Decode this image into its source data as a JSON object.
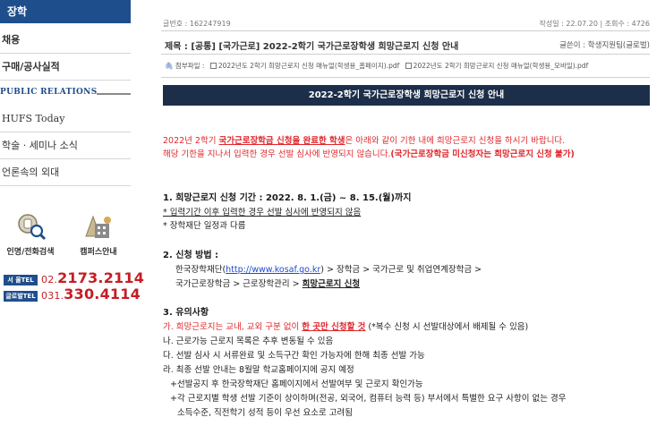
{
  "sidebar": {
    "active": "장학",
    "items": [
      "채용",
      "구매/공사실적"
    ],
    "section": "PUBLIC RELATIONS",
    "pr_items": [
      "HUFS Today",
      "학술 · 세미나 소식",
      "언론속의 외대"
    ],
    "quick": [
      {
        "label": "인명/전화검색",
        "icon": "phone-search-icon"
      },
      {
        "label": "캠퍼스안내",
        "icon": "campus-map-icon"
      }
    ],
    "tels": [
      {
        "badge": "서 울TEL",
        "prefix": "02.",
        "number": "2173.2114"
      },
      {
        "badge": "글로벌TEL",
        "prefix": "031.",
        "number": "330.4114"
      }
    ]
  },
  "post": {
    "id_label": "글번호 : 162247919",
    "date_views": "작성일 : 22.07.20  |  조회수 : 4726",
    "title": "제목 : [공통] [국가근로] 2022-2학기 국가근로장학생 희망근로지 신청 안내",
    "author": "글쓴이 : 학생지원팀(글로벌)",
    "attach_label": "첨부파일 :",
    "attachments": [
      "2022년도 2학기 희망근로지 신청 매뉴얼(학생용_홈페이지).pdf",
      "2022년도 2학기 희망근로지 신청 매뉴얼(학생용_모바일).pdf"
    ],
    "banner": "2022-2학기 국가근로장학생 희망근로지 신청 안내",
    "intro1_a": "2022년 2학기 ",
    "intro1_b": "국가근로장학금 신청을 완료한 학생",
    "intro1_c": "은 아래와 같이 기한 내에 희망근로지 신청을 하시기 바랍니다.",
    "intro2_a": "해당 기한을 지나서 입력한 경우 선발 심사에 반영되지 않습니다.",
    "intro2_b": "(국가근로장학금 미신청자는 희망근로지 신청 불가)",
    "s1_title": "1. 희망근로지 신청 기간 : 2022. 8. 1.(금) ~ 8. 15.(월)까지",
    "s1_b1": "* 입력기간 이후 입력한 경우 선발 심사에 반영되지 않음",
    "s1_b2": "* 장학재단 일정과 다름",
    "s2_title": "2. 신청 방법 :",
    "s2_l1_a": "한국장학재단(",
    "s2_l1_link": "http://www.kosaf.go.kr",
    "s2_l1_b": ") > 장학금 > 국가근로 및 취업연계장학금 >",
    "s2_l2_a": "국가근로장학금 > 근로장학관리 > ",
    "s2_l2_b": "희망근로지 신청",
    "s3_title": "3. 유의사항",
    "s3_ga_a": "가. 희망근로지는 교내, 교외 구분 없이 ",
    "s3_ga_b": "한 곳만 신청할 것",
    "s3_ga_c": " (*복수 신청 시 선발대상에서 배제될 수 있음)",
    "s3_na": "나. 근로가능 근로지 목록은 추후 변동될 수 있음",
    "s3_da": "다.  선발 심사 시 서류완료 및 소득구간 확인 가능자에 한해 최종 선발 가능",
    "s3_ra": "라. 최종 선발 안내는 8월말 학교홈페이지에 공지 예정",
    "s3_n1": "+선발공지 후 한국장학재단 홈페이지에서 선발여부 및 근로지 확인가능",
    "s3_n2": "+각 근로지별 학생 선발 기준이 상이하며(전공, 외국어, 컴퓨터 능력 등) 부서에서 특별한 요구 사항이 없는 경우",
    "s3_n3": "소득수준, 직전학기 성적 등이 우선 요소로 고려됨"
  }
}
